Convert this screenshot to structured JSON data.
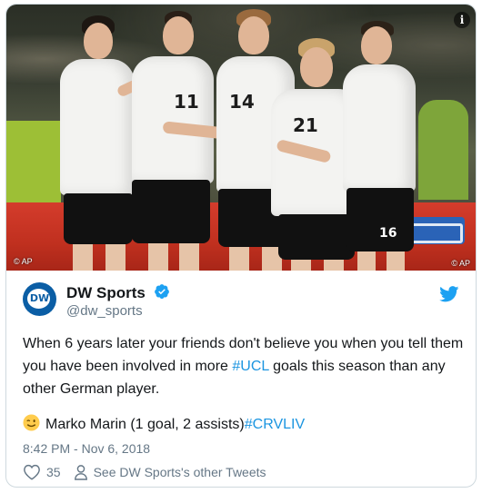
{
  "photo": {
    "credit_left": "© AP",
    "credit_right": "© AP",
    "players": [
      {
        "number": "11"
      },
      {
        "number": "14"
      },
      {
        "number": "21"
      },
      {
        "number": "16"
      }
    ],
    "info_icon": "info-icon"
  },
  "tweet": {
    "author_name": "DW Sports",
    "author_handle": "@dw_sports",
    "avatar_text": "DW",
    "verified_icon": "verified-badge-icon",
    "platform_icon": "twitter-bird-icon",
    "text_before_hashtag": "When 6 years later your friends don't believe you when you tell them you have been involved in more ",
    "hashtag_1": "#UCL",
    "text_after_hashtag": " goals this season than any other German player.",
    "emoji": "winking-face-icon",
    "line2_text": "Marko Marin (1 goal, 2 assists)",
    "hashtag_2": "#CRVLIV",
    "timestamp": "8:42 PM - Nov 6, 2018",
    "like_count": "35",
    "other_tweets_label": "See DW Sports's other Tweets"
  },
  "colors": {
    "link": "#1b95e0",
    "secondary_text": "#657786",
    "brand_blue": "#0b5ea5"
  }
}
